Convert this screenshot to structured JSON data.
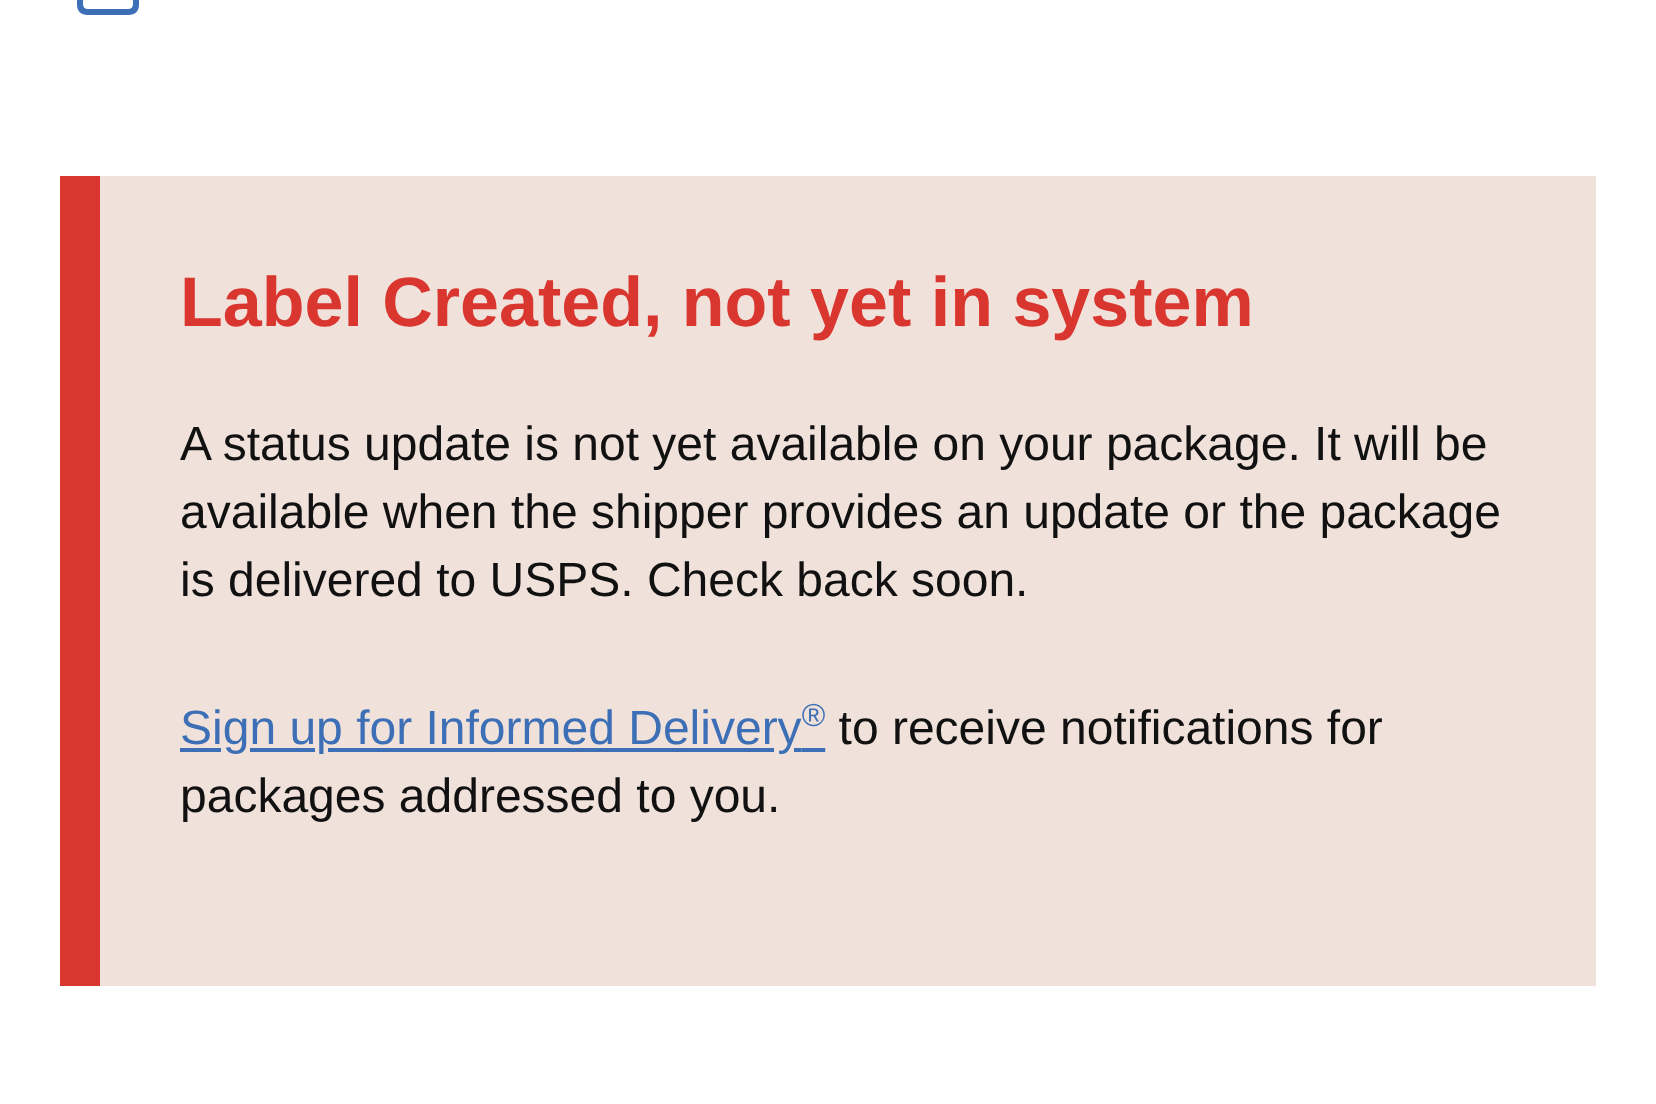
{
  "alert": {
    "title": "Label Created, not yet in system",
    "message": "A status update is not yet available on your package. It will be available when the shipper provides an update or the package is delivered to USPS. Check back soon.",
    "link": "Sign up for Informed Delivery$^{®}$",
    "link_suffix": " to receive notifications for packages addressed to you."
  }
}
